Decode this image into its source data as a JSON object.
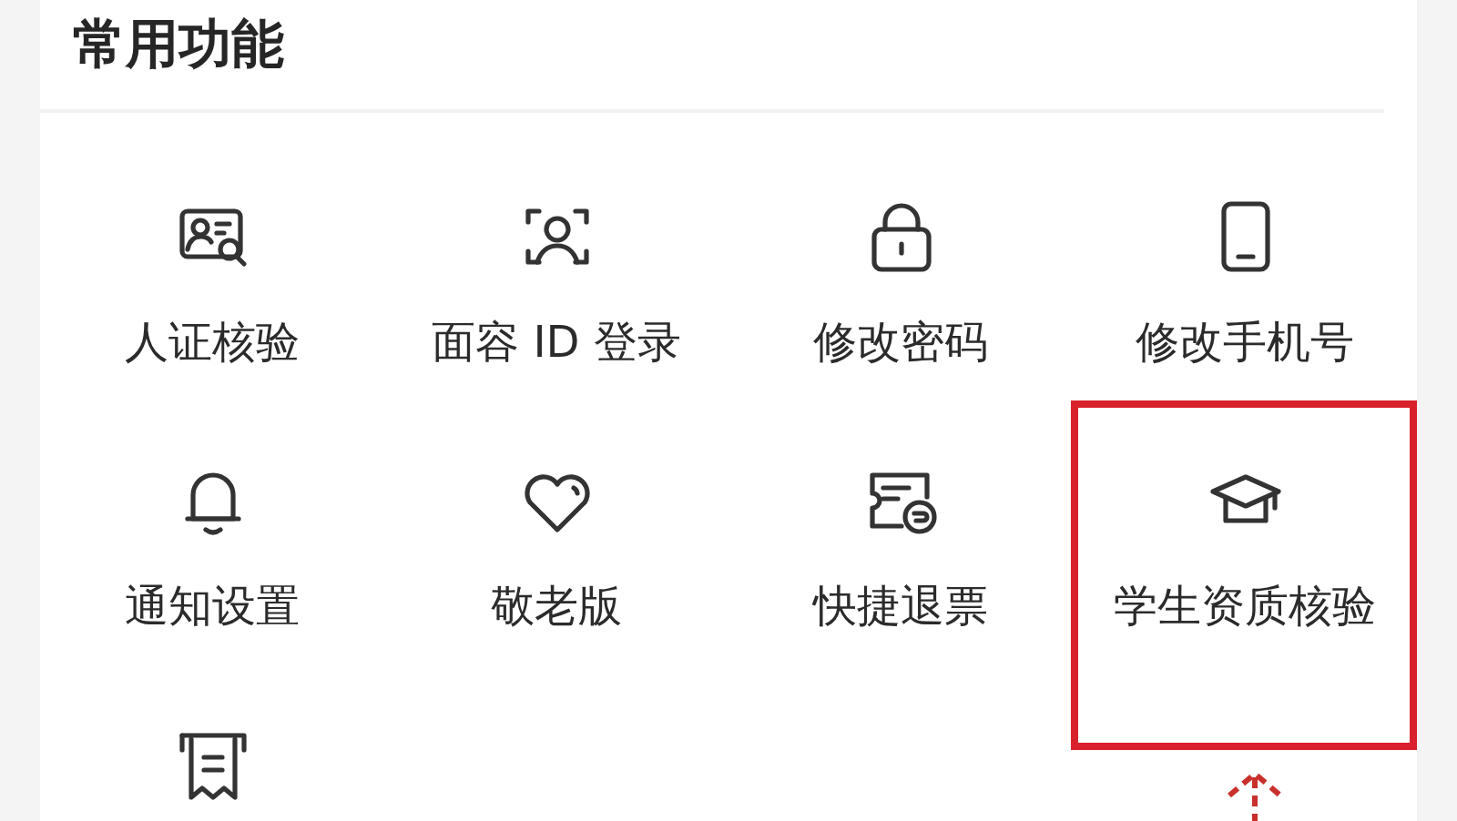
{
  "title": "常用功能",
  "items": [
    {
      "label": "人证核验",
      "highlighted": false
    },
    {
      "label": "面容 ID 登录",
      "highlighted": false
    },
    {
      "label": "修改密码",
      "highlighted": false
    },
    {
      "label": "修改手机号",
      "highlighted": false
    },
    {
      "label": "通知设置",
      "highlighted": false
    },
    {
      "label": "敬老版",
      "highlighted": false
    },
    {
      "label": "快捷退票",
      "highlighted": false
    },
    {
      "label": "学生资质核验",
      "highlighted": true
    },
    {
      "highlighted": false
    }
  ]
}
